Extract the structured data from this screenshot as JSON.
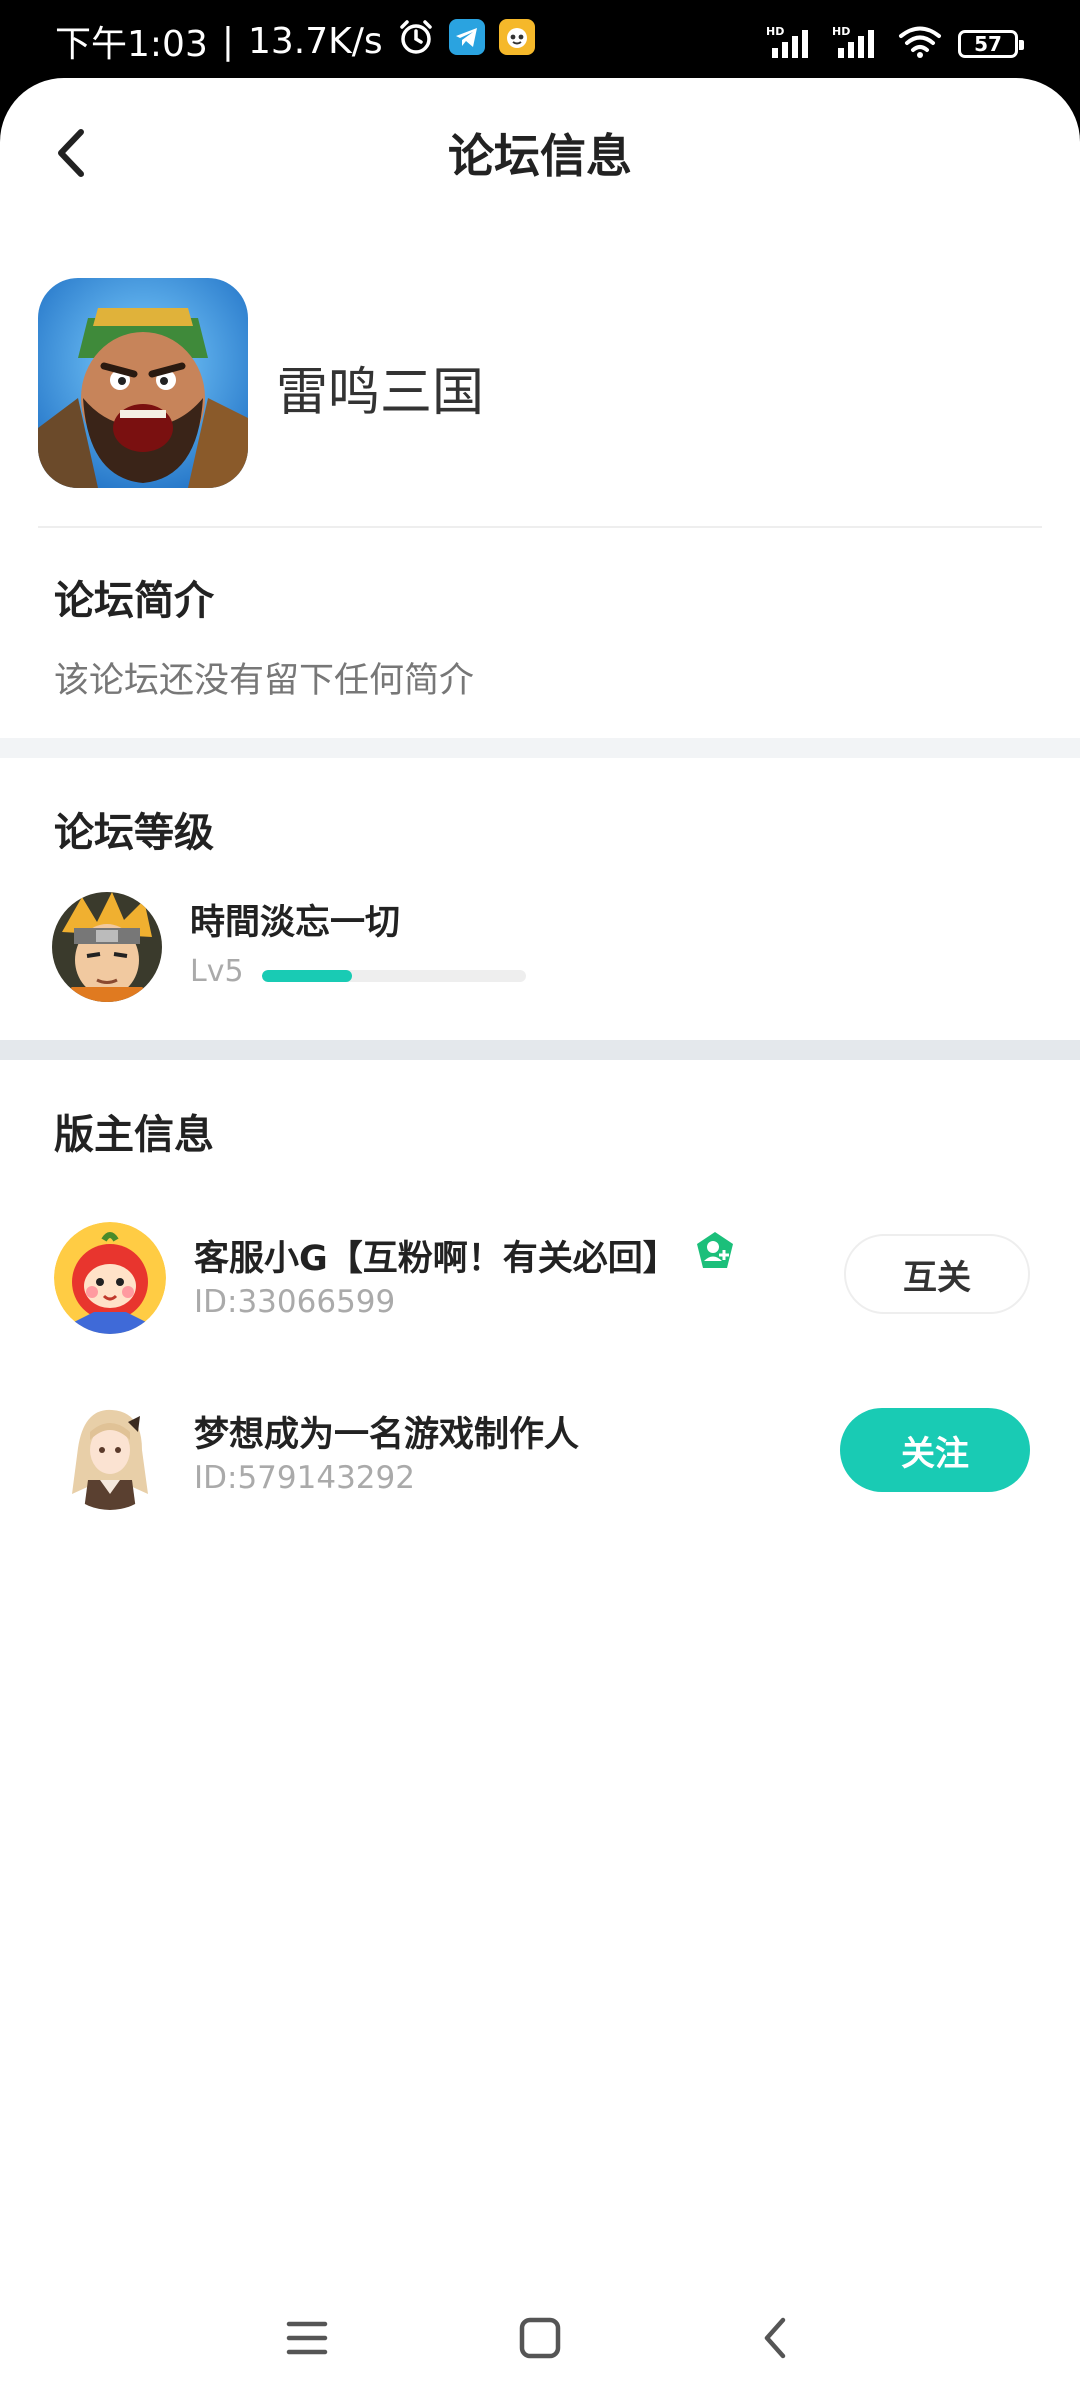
{
  "status_bar": {
    "time": "下午1:03",
    "separator": "|",
    "net_speed": "13.7K/s",
    "battery_level": "57",
    "signal_label_1": "HD",
    "signal_label_2": "HD",
    "icons": [
      "alarm-icon",
      "telegram-icon",
      "app-notification-icon",
      "signal-hd-icon",
      "signal-hd-icon",
      "wifi-icon",
      "battery-icon"
    ]
  },
  "header": {
    "title": "论坛信息",
    "back_icon": "chevron-left-icon"
  },
  "game": {
    "name": "雷鸣三国"
  },
  "intro": {
    "title": "论坛简介",
    "text": "该论坛还没有留下任何简介"
  },
  "level": {
    "title": "论坛等级",
    "user_name": "時間淡忘一切",
    "level_label": "Lv5",
    "progress": 0.34
  },
  "moderators": {
    "title": "版主信息",
    "items": [
      {
        "name": "客服小G【互粉啊！有关必回】",
        "id": "ID:33066599",
        "badge_icon": "verified-badge-icon",
        "action": "互关"
      },
      {
        "name": "梦想成为一名游戏制作人",
        "id": "ID:579143292",
        "action": "关注"
      }
    ]
  },
  "nav": {
    "icons": [
      "menu-icon",
      "home-icon",
      "back-icon"
    ]
  },
  "colors": {
    "accent": "#19cbb4",
    "background": "#ffffff",
    "separator": "#f2f4f6",
    "muted_text": "#aaaaaa"
  }
}
